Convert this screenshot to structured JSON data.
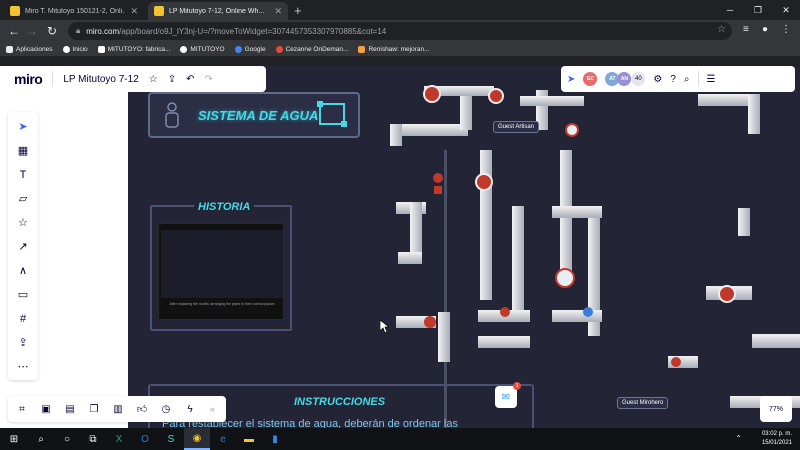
{
  "browser": {
    "tabs": [
      {
        "title": "Miro T. Mitutoyo 150121-2, Onli...",
        "active": false
      },
      {
        "title": "LP Mitutoyo 7-12, Online Wh...",
        "active": true
      }
    ],
    "url_domain": "miro.com",
    "url_path": "/app/board/o9J_lY3nj-U=/?moveToWidget=3074457353307970885&cot=14",
    "bookmarks": [
      "Aplicaciones",
      "Inicio",
      "MITUTOYO: fabrica...",
      "MITUTOYO",
      "Google",
      "Cezanne OnDeman...",
      "Renishaw: mejoran..."
    ]
  },
  "miro": {
    "logo": "miro",
    "board_name": "LP Mitutoyo 7-12",
    "avatars": [
      {
        "initials": "EC",
        "color": "#e86a6a"
      },
      {
        "initials": "AT",
        "color": "#7fa7d8"
      },
      {
        "initials": "AN",
        "color": "#9a8fd8"
      }
    ],
    "participant_count": "40",
    "zoom": "77%",
    "chat_badge": "1"
  },
  "board": {
    "title": "SISTEMA DE AGUA",
    "history_title": "HISTORIA",
    "history_caption": "After replacing the model, arranging the pipes in their correct places",
    "instructions_title": "INSTRUCCIONES",
    "instructions_text": "Para restablecer el sistema de agua, deberán de ordenar las",
    "guests": [
      "Guest Artisan",
      "Guest Mirohero"
    ]
  },
  "taskbar": {
    "time": "03:02 p. m.",
    "date": "15/01/2021"
  }
}
